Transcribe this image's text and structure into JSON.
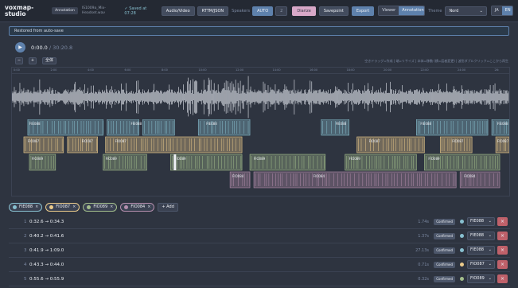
{
  "app": {
    "title": "voxmap-studio",
    "mode_badge": "Annotation",
    "file_name": "IS1009a_Mix-Headset.wav",
    "saved_status": "✓ Saved at 07:28"
  },
  "toolbar": {
    "audio_video": "Audio/Video",
    "rttm_json": "RTTM/JSON",
    "speakers_label": "Speakers",
    "speakers_auto": "AUTO",
    "speakers_count": "2",
    "diarize": "Diarize",
    "savepoint": "Savepoint",
    "export": "Export",
    "view_modes": [
      "Viewer",
      "Annotation"
    ],
    "view_active": "Annotation",
    "theme_label": "Theme",
    "theme_value": "Nord",
    "langs": [
      "JA",
      "EN"
    ],
    "lang_active": "EN"
  },
  "notice": "Restored from auto-save",
  "playback": {
    "current": "0:00.0",
    "separator": " / ",
    "total": "30:20.8"
  },
  "zoom": {
    "out": "−",
    "in": "+",
    "all": "全体"
  },
  "hint": "空きドラッグ=作成 | 端=リサイズ | 本体=移動 (横=話者変更) | 波形ダブルクリック=ここから再生",
  "ruler": [
    "0:00",
    "2:00",
    "4:00",
    "6:00",
    "8:00",
    "10:00",
    "12:00",
    "14:00",
    "16:00",
    "18:00",
    "20:00",
    "22:00",
    "24:00",
    "26:"
  ],
  "speakers": [
    {
      "id": "FIE088",
      "color": "#88c0d0"
    },
    {
      "id": "FIO087",
      "color": "#ebcb8b"
    },
    {
      "id": "FIO089",
      "color": "#a3be8c"
    },
    {
      "id": "FIO084",
      "color": "#b48ead"
    }
  ],
  "lane_labels": {
    "lane0": [
      "FIE088",
      "FIE088",
      "FIE088",
      "FIE088",
      "FIE088",
      "FIE088"
    ],
    "lane1": [
      "FIO087",
      "FIO087",
      "FIO087",
      "FIO087",
      "FIO087",
      "FIO087"
    ],
    "lane2": [
      "FIO089",
      "FIO089",
      "FIO089",
      "FIO089",
      "FIO089",
      "FIO089"
    ],
    "lane3": [
      "FIO084",
      "FIO084",
      "FIO084"
    ]
  },
  "chips_add": "+ Add",
  "segments": [
    {
      "idx": "1",
      "range": "0:32.6 → 0:34.3",
      "duration": "1.74s",
      "status": "Confirmed",
      "speaker": "FIE088",
      "color": "#88c0d0"
    },
    {
      "idx": "2",
      "range": "0:40.2 → 0:41.6",
      "duration": "1.37s",
      "status": "Confirmed",
      "speaker": "FIE088",
      "color": "#88c0d0"
    },
    {
      "idx": "3",
      "range": "0:41.9 → 1:09.0",
      "duration": "27.13s",
      "status": "Confirmed",
      "speaker": "FIE088",
      "color": "#88c0d0"
    },
    {
      "idx": "4",
      "range": "0:43.3 → 0:44.0",
      "duration": "0.71s",
      "status": "Confirmed",
      "speaker": "FIO087",
      "color": "#ebcb8b"
    },
    {
      "idx": "5",
      "range": "0:55.6 → 0:55.9",
      "duration": "0.32s",
      "status": "Confirmed",
      "speaker": "FIO089",
      "color": "#a3be8c"
    }
  ]
}
